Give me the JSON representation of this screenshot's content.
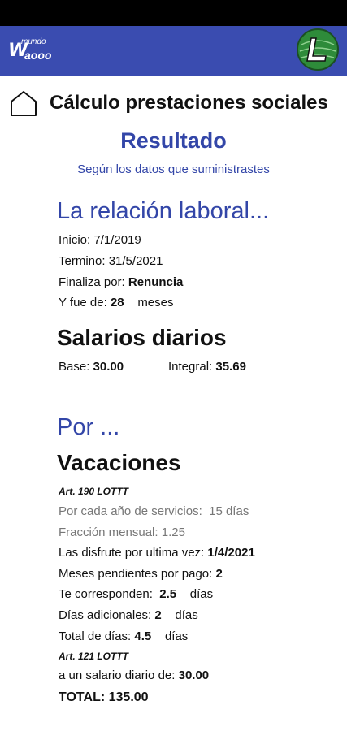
{
  "header": {
    "logo_small": "mundo",
    "logo_big": "W",
    "logo_sub": "aooo"
  },
  "page": {
    "title": "Cálculo prestaciones sociales",
    "result_heading": "Resultado",
    "result_sub": "Según los datos que suministrastes"
  },
  "relation": {
    "heading": "La relación laboral...",
    "inicio_label": "Inicio:",
    "inicio_value": "7/1/2019",
    "termino_label": "Termino:",
    "termino_value": "31/5/2021",
    "finaliza_label": "Finaliza por:",
    "finaliza_value": "Renuncia",
    "fue_label": "Y fue de:",
    "fue_value": "28",
    "fue_unit": "meses"
  },
  "salaries": {
    "heading": "Salarios diarios",
    "base_label": "Base:",
    "base_value": "30.00",
    "integral_label": "Integral:",
    "integral_value": "35.69"
  },
  "por": {
    "heading": "Por ..."
  },
  "vacaciones": {
    "heading": "Vacaciones",
    "ref1": "Art. 190 LOTTT",
    "por_cada_label": "Por cada año de servicios:",
    "por_cada_value": "15 días",
    "fraccion_label": "Fracción mensual:",
    "fraccion_value": "1.25",
    "disfrute_label": "Las disfrute por ultima vez:",
    "disfrute_value": "1/4/2021",
    "meses_label": "Meses pendientes por pago:",
    "meses_value": "2",
    "corresponden_label": "Te corresponden:",
    "corresponden_value": "2.5",
    "corresponden_unit": "días",
    "adicionales_label": "Días adicionales:",
    "adicionales_value": "2",
    "adicionales_unit": "días",
    "total_dias_label": "Total de días:",
    "total_dias_value": "4.5",
    "total_dias_unit": "días",
    "ref2": "Art. 121 LOTTT",
    "salario_label": "a un salario diario de:",
    "salario_value": "30.00",
    "total_label": "TOTAL:",
    "total_value": "135.00"
  },
  "colors": {
    "header_bg": "#3a4cb0",
    "accent": "#3346a8"
  },
  "icons": {
    "home": "home-icon",
    "brand": "brand-logo-icon"
  }
}
